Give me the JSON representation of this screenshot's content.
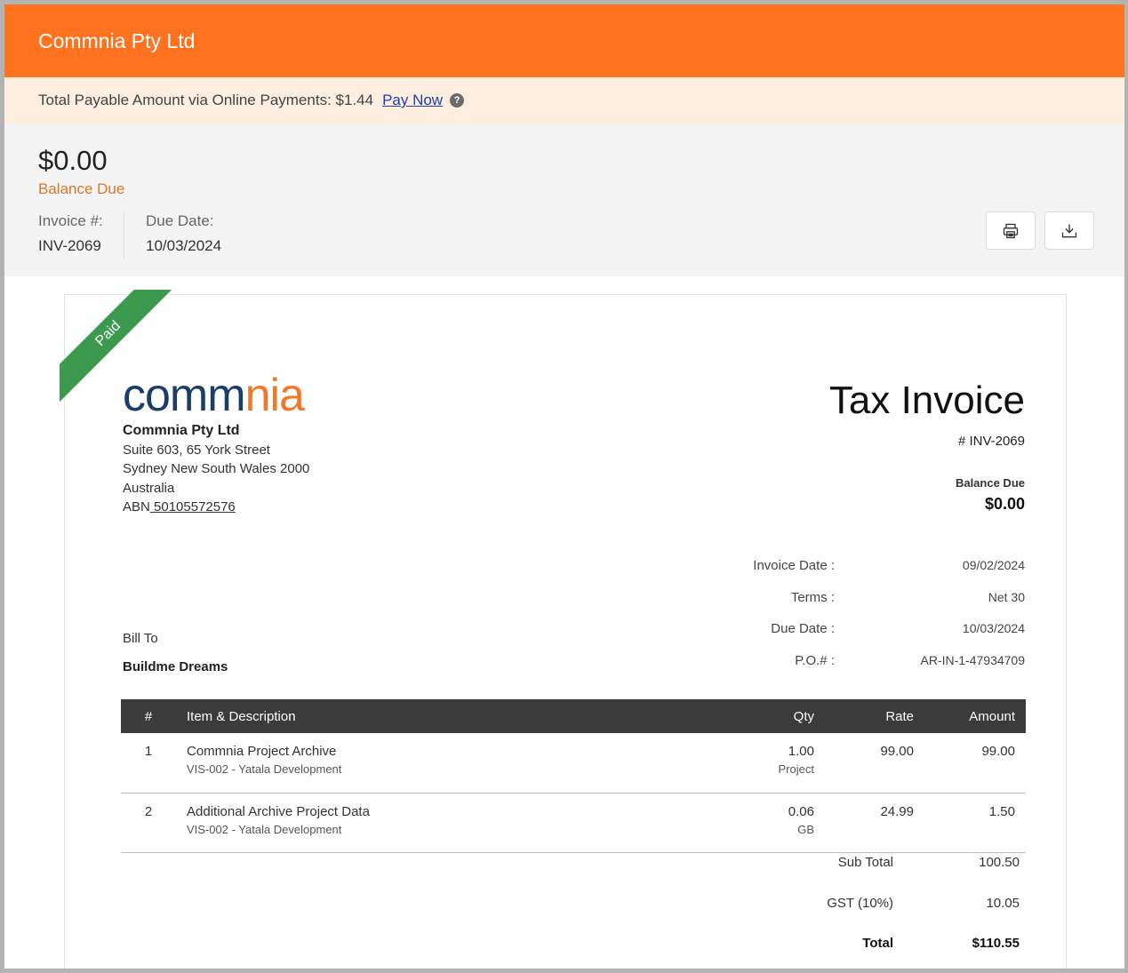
{
  "header": {
    "company": "Commnia Pty Ltd"
  },
  "payment_bar": {
    "text": "Total Payable Amount via Online Payments: $1.44",
    "pay_now": "Pay Now",
    "help_icon": "help-icon"
  },
  "summary": {
    "amount": "$0.00",
    "balance_label": "Balance Due",
    "invoice_label": "Invoice #:",
    "invoice_value": "INV-2069",
    "due_label": "Due Date:",
    "due_value": "10/03/2024",
    "print_icon": "print-icon",
    "download_icon": "download-icon"
  },
  "invoice": {
    "ribbon": "Paid",
    "logo_text": "commnia",
    "company": {
      "name": "Commnia Pty Ltd",
      "address1": "Suite 603, 65 York Street",
      "address2": "Sydney New South Wales 2000",
      "country": "Australia",
      "abn_label": "ABN",
      "abn_value": " 50105572576"
    },
    "title": "Tax Invoice",
    "number": "# INV-2069",
    "balance_due_label": "Balance Due",
    "balance_due_value": "$0.00",
    "details": [
      {
        "label": "Invoice Date :",
        "value": "09/02/2024"
      },
      {
        "label": "Terms :",
        "value": "Net 30"
      },
      {
        "label": "Due Date :",
        "value": "10/03/2024"
      },
      {
        "label": "P.O.# :",
        "value": "AR-IN-1-47934709"
      }
    ],
    "bill_to_label": "Bill To",
    "bill_to_name": "Buildme Dreams",
    "columns": {
      "num": "#",
      "desc": "Item & Description",
      "qty": "Qty",
      "rate": "Rate",
      "amount": "Amount"
    },
    "items": [
      {
        "num": "1",
        "name": "Commnia Project Archive",
        "sub": "VIS-002 - Yatala Development",
        "qty": "1.00",
        "unit": "Project",
        "rate": "99.00",
        "amount": "99.00"
      },
      {
        "num": "2",
        "name": "Additional Archive Project Data",
        "sub": "VIS-002 - Yatala Development",
        "qty": "0.06",
        "unit": "GB",
        "rate": "24.99",
        "amount": "1.50"
      }
    ],
    "totals": {
      "sub_label": "Sub Total",
      "sub_value": "100.50",
      "gst_label": "GST (10%)",
      "gst_value": "10.05",
      "total_label": "Total",
      "total_value": "$110.55"
    }
  }
}
